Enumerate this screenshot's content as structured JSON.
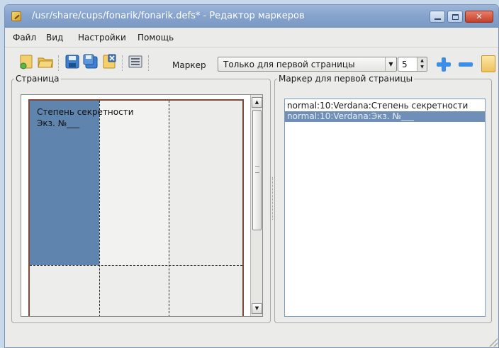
{
  "window": {
    "title": "/usr/share/cups/fonarik/fonarik.defs* - Редактор маркеров",
    "controls": {
      "minimize": "minimize",
      "maximize": "maximize",
      "close": "✕"
    }
  },
  "menubar": {
    "items": [
      {
        "label": "Файл"
      },
      {
        "label": "Вид"
      },
      {
        "label": "Настройки"
      },
      {
        "label": "Помощь"
      }
    ]
  },
  "toolbar": {
    "icons": [
      "new-file-icon",
      "open-folder-icon",
      "save-icon",
      "save-as-icon",
      "clear-icon",
      "properties-icon"
    ],
    "marker_label": "Маркер",
    "marker_select": {
      "value": "Только для первой страницы",
      "arrow": "▼"
    },
    "spin": {
      "value": "5",
      "up": "▲",
      "down": "▼"
    }
  },
  "page_panel": {
    "legend": "Страница",
    "text_lines": [
      "Степень секретности",
      "Экз. №___"
    ],
    "scrollbar": {
      "up": "▲",
      "down": "▼"
    }
  },
  "marker_panel": {
    "legend": "Маркер для первой страницы",
    "items": [
      {
        "text": "normal:10:Verdana:Степень секретности",
        "selected": false
      },
      {
        "text": "normal:10:Verdana:Экз. №___",
        "selected": true
      }
    ]
  },
  "colors": {
    "titlebar": "#86a3cc",
    "selected_zone": "#5f84ad",
    "list_selection": "#6f8fb8",
    "accent_icon": "#3d8ee8"
  }
}
